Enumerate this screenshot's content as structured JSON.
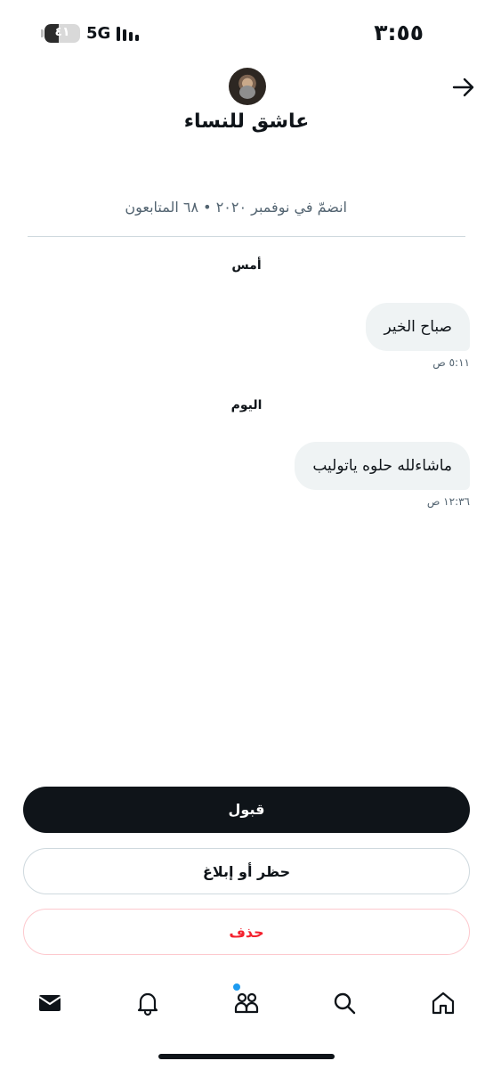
{
  "status_bar": {
    "time": "٣:٥٥",
    "network": "5G",
    "battery": "٤١",
    "battery_level": 0.41
  },
  "header": {
    "back_icon": "arrow-right-icon",
    "profile_name": "عاشق للنساء",
    "profile_meta": "انضمّ في نوفمبر ٢٠٢٠ • ٦٨ المتابعون"
  },
  "conversation": [
    {
      "date_label": "أمس",
      "message": "صباح الخير",
      "time": "٥:١١ ص"
    },
    {
      "date_label": "اليوم",
      "message": "ماشاءلله حلوه ياتوليب",
      "time": "١٢:٣٦ ص"
    }
  ],
  "actions": {
    "accept": "قبول",
    "block_report": "حظر أو إبلاغ",
    "delete": "حذف"
  },
  "bottom_nav": {
    "items": [
      "mail-icon",
      "bell-icon",
      "people-icon",
      "search-icon",
      "home-icon"
    ],
    "notification_dot_color": "#1d9bf0"
  },
  "colors": {
    "accent": "#1d9bf0",
    "danger": "#f4212e",
    "primary_button": "#0f1419"
  }
}
